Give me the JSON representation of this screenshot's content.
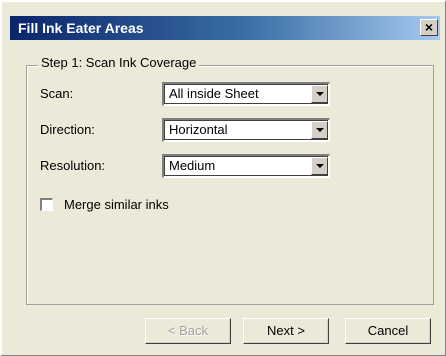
{
  "window": {
    "title": "Fill Ink Eater Areas",
    "close_glyph": "×",
    "close_icon": "close-icon"
  },
  "group": {
    "legend": "Step 1: Scan Ink Coverage"
  },
  "fields": {
    "scan": {
      "label": "Scan:",
      "value": "All inside Sheet"
    },
    "direction": {
      "label": "Direction:",
      "value": "Horizontal"
    },
    "resolution": {
      "label": "Resolution:",
      "value": "Medium"
    }
  },
  "options": {
    "merge_similar_inks": {
      "label": "Merge similar inks",
      "checked": false
    }
  },
  "buttons": {
    "back": "< Back",
    "next": "Next >",
    "cancel": "Cancel"
  },
  "colors": {
    "title_gradient_start": "#0a246a",
    "title_gradient_end": "#a6caf0",
    "dialog_background": "#ece9d8",
    "disabled_text": "#a0a0a0"
  }
}
